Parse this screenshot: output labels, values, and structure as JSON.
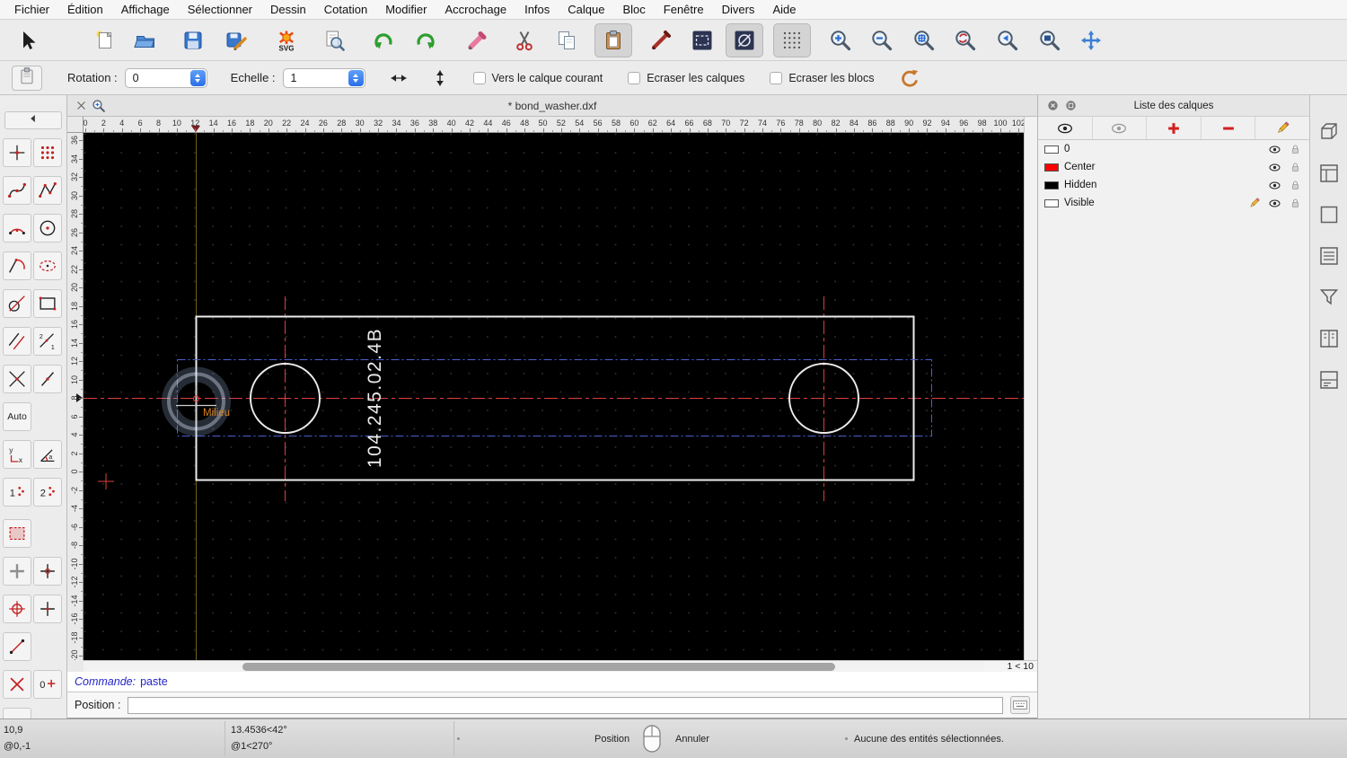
{
  "menu_items": [
    "Fichier",
    "Édition",
    "Affichage",
    "Sélectionner",
    "Dessin",
    "Cotation",
    "Modifier",
    "Accrochage",
    "Infos",
    "Calque",
    "Bloc",
    "Fenêtre",
    "Divers",
    "Aide"
  ],
  "toolbar_main": [
    {
      "name": "select-pointer",
      "glyph": "cursor",
      "gap": 10
    },
    {
      "name": "new-document",
      "glyph": "newdoc",
      "gap": 44
    },
    {
      "name": "open-document",
      "glyph": "open",
      "gap": 3
    },
    {
      "name": "save-document",
      "glyph": "save",
      "gap": 11
    },
    {
      "name": "save-as",
      "glyph": "saveas",
      "gap": 6
    },
    {
      "name": "export-svg",
      "glyph": "svgexp",
      "gap": 14
    },
    {
      "name": "print-preview",
      "glyph": "preview",
      "gap": 11
    },
    {
      "name": "undo",
      "glyph": "undo",
      "gap": 13
    },
    {
      "name": "redo",
      "glyph": "redo",
      "gap": 5
    },
    {
      "name": "delete-entities",
      "glyph": "delpen",
      "gap": 15
    },
    {
      "name": "cut",
      "glyph": "cut",
      "gap": 11
    },
    {
      "name": "copy",
      "glyph": "copy",
      "gap": 5
    },
    {
      "name": "paste",
      "glyph": "paste",
      "gap": 10,
      "active": true
    },
    {
      "name": "draw-pen",
      "glyph": "penred",
      "gap": 11
    },
    {
      "name": "edit-attributes",
      "glyph": "darkrect",
      "gap": 4
    },
    {
      "name": "circle-tool",
      "glyph": "darkcircle",
      "gap": 5,
      "active": true
    },
    {
      "name": "grid-toggle",
      "glyph": "griddots",
      "gap": 11,
      "active": true
    },
    {
      "name": "zoom-in",
      "glyph": "zoomin",
      "gap": 12
    },
    {
      "name": "zoom-out",
      "glyph": "zoomout",
      "gap": 4
    },
    {
      "name": "zoom-auto",
      "glyph": "zoomauto",
      "gap": 5
    },
    {
      "name": "zoom-redraw",
      "glyph": "zoomredraw",
      "gap": 4
    },
    {
      "name": "zoom-previous",
      "glyph": "zoomprev",
      "gap": 5
    },
    {
      "name": "zoom-window",
      "glyph": "zoomwindow",
      "gap": 5
    },
    {
      "name": "zoom-pan",
      "glyph": "zoompan",
      "gap": 4
    }
  ],
  "options_bar": {
    "rotation_label": "Rotation :",
    "rotation_value": "0",
    "scale_label": "Echelle :",
    "scale_value": "1",
    "checkbox_labels": [
      "Vers le calque courant",
      "Ecraser les calques",
      "Ecraser les blocs"
    ]
  },
  "tab": {
    "title": "* bond_washer.dxf"
  },
  "palette": {
    "tools": [
      {
        "name": "draw-point",
        "glyph": "t_point"
      },
      {
        "name": "draw-hatch",
        "glyph": "t_dots"
      },
      {
        "name": "draw-spline",
        "glyph": "t_spline"
      },
      {
        "name": "draw-polyline",
        "glyph": "t_poly"
      },
      {
        "name": "draw-arc",
        "glyph": "t_arc"
      },
      {
        "name": "draw-circle",
        "glyph": "t_circle"
      },
      {
        "name": "draw-arc-continuation",
        "glyph": "t_arc2"
      },
      {
        "name": "draw-ellipse",
        "glyph": "t_ellipse"
      },
      {
        "name": "draw-tangent-line",
        "glyph": "t_tangent"
      },
      {
        "name": "draw-rectangle",
        "glyph": "t_rect"
      },
      {
        "name": "draw-parallel",
        "glyph": "t_parallel"
      },
      {
        "name": "draw-bisector",
        "glyph": "t_21"
      },
      {
        "name": "draw-line-cross",
        "glyph": "t_linex"
      },
      {
        "name": "draw-line-angle",
        "glyph": "t_slash"
      },
      {
        "name": "snap-auto",
        "label": "Auto"
      },
      {},
      {
        "name": "restrict-orthogonal",
        "glyph": "t_yx"
      },
      {
        "name": "snap-angle",
        "glyph": "t_angle"
      },
      {
        "name": "snap-grid-coarse",
        "glyph": "t_1dots"
      },
      {
        "name": "snap-grid-fine",
        "glyph": "t_2dots"
      },
      {
        "name": "select-window",
        "glyph": "t_selred",
        "gap_before": true
      },
      {},
      {
        "name": "snap-free",
        "glyph": "t_plusgray"
      },
      {
        "name": "snap-grid",
        "glyph": "t_crossdot"
      },
      {
        "name": "snap-center",
        "glyph": "t_circplus"
      },
      {
        "name": "snap-endpoint",
        "glyph": "t_cross2"
      },
      {
        "name": "snap-distance",
        "glyph": "t_slashdots"
      },
      {},
      {
        "name": "snap-intersection",
        "glyph": "t_xred"
      },
      {
        "name": "set-relative-zero",
        "glyph": "t_zeroplus"
      },
      {
        "name": "lock-relative-zero",
        "glyph": "t_zerodash"
      },
      {}
    ]
  },
  "drawing": {
    "part_number": "104.245.02.4B",
    "snap_label": "Milieu",
    "zoom_status": "1 < 10",
    "hruler_labels": [
      "0",
      "2",
      "4",
      "6",
      "8",
      "10",
      "12",
      "14",
      "16",
      "18",
      "20",
      "22",
      "24",
      "26",
      "28",
      "30",
      "32",
      "34",
      "36",
      "38",
      "40",
      "42",
      "44",
      "46",
      "48",
      "50",
      "52",
      "54",
      "56",
      "58",
      "60",
      "62",
      "64",
      "66",
      "68",
      "70",
      "72",
      "74",
      "76",
      "78",
      "80",
      "82",
      "84",
      "86",
      "88",
      "90",
      "92",
      "94",
      "96",
      "98",
      "100",
      "102"
    ],
    "vruler_labels": [
      "36",
      "34",
      "32",
      "30",
      "28",
      "26",
      "24",
      "22",
      "20",
      "18",
      "16",
      "14",
      "12",
      "10",
      "8",
      "6",
      "4",
      "2",
      "0",
      "-2",
      "-4",
      "-6",
      "-8",
      "-10",
      "-12",
      "-14",
      "-16",
      "-18",
      "-20"
    ]
  },
  "colors": {
    "canvas_background": "#000000",
    "entity": "#ececec",
    "centerline": "#e03c3c",
    "hidden_entity": "#4a5fd0",
    "construction": "#6e5f1e",
    "crosshair": "#d0d0d0",
    "snap_label": "#d9831f"
  },
  "layer_panel": {
    "title": "Liste des calques",
    "layers": [
      {
        "name": "0",
        "color": "#ffffff",
        "visible": true,
        "locked": false,
        "current": false
      },
      {
        "name": "Center",
        "color": "#ff0000",
        "visible": true,
        "locked": false,
        "current": false
      },
      {
        "name": "Hidden",
        "color": "#000000",
        "visible": true,
        "locked": false,
        "current": false
      },
      {
        "name": "Visible",
        "color": "#ffffff",
        "visible": true,
        "locked": false,
        "current": true
      }
    ]
  },
  "dock_items": [
    {
      "name": "dock-block-list",
      "glyph": "d_cube"
    },
    {
      "name": "dock-layer-list",
      "glyph": "d_layers"
    },
    {
      "name": "dock-blank-panel",
      "glyph": "d_blank"
    },
    {
      "name": "dock-entity-list",
      "glyph": "d_list"
    },
    {
      "name": "dock-filter",
      "glyph": "d_funnel"
    },
    {
      "name": "dock-library-browser",
      "glyph": "d_book"
    },
    {
      "name": "dock-command-history",
      "glyph": "d_lines"
    }
  ],
  "command_area": {
    "prompt": "Commande:",
    "command": "paste",
    "position_label": "Position :",
    "position_value": ""
  },
  "status_bar": {
    "abs_coord": "10,9",
    "rel_coord": "@0,-1",
    "polar_abs": "13.4536<42°",
    "polar_rel": "@1<270°",
    "left_button": "Position",
    "right_button": "Annuler",
    "selection_info": "Aucune des entités sélectionnées."
  }
}
